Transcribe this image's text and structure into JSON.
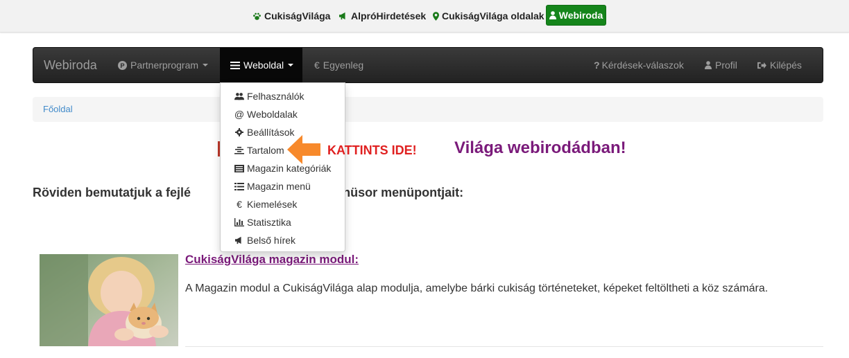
{
  "topbar": {
    "links": [
      {
        "label": "CukiságVilága",
        "icon": "paw-icon"
      },
      {
        "label": "AlpróHirdetések",
        "icon": "bullhorn-icon"
      },
      {
        "label": "CukiságVilága oldalak",
        "icon": "map-marker-icon"
      }
    ],
    "webiroda_button": "Webiroda",
    "accent": "#15851b"
  },
  "navbar": {
    "brand": "Webiroda",
    "items_left": [
      {
        "label": "Partnerprogram",
        "icon": "p-circle-icon",
        "dropdown": true
      },
      {
        "label": "Weboldal",
        "icon": "list-icon",
        "dropdown": true,
        "active": true
      },
      {
        "label": "Egyenleg",
        "icon": "euro-icon"
      }
    ],
    "items_right": [
      {
        "label": "Kérdések-válaszok",
        "icon": "question-icon"
      },
      {
        "label": "Profil",
        "icon": "user-icon"
      },
      {
        "label": "Kilépés",
        "icon": "logout-icon"
      }
    ]
  },
  "dropdown": {
    "items": [
      {
        "label": "Felhasználók",
        "icon": "users-icon"
      },
      {
        "label": "Weboldalak",
        "icon": "at-icon"
      },
      {
        "label": "Beállítások",
        "icon": "gear-icon"
      },
      {
        "label": "Tartalom",
        "icon": "align-center-icon"
      },
      {
        "label": "Magazin kategóriák",
        "icon": "list-alt-icon"
      },
      {
        "label": "Magazin menü",
        "icon": "list-icon"
      },
      {
        "label": "Kiemelések",
        "icon": "euro-icon"
      },
      {
        "label": "Statisztika",
        "icon": "bar-chart-icon"
      },
      {
        "label": "Belső hírek",
        "icon": "bullhorn-icon"
      }
    ]
  },
  "breadcrumb": {
    "home": "Főoldal"
  },
  "welcome_heading": "Világa webirodádban!",
  "annotation": {
    "text": "KATTINTS IDE!"
  },
  "intro": {
    "left": "Röviden bemutatjuk a fejlé",
    "right": "gfelső menüsor menüpontjait:"
  },
  "article": {
    "title": "CukiságVilága magazin modul:",
    "body": "A Magazin modul a CukiságVilága alap modulja, amelybe bárki cukiság történeteket, képeket feltöltheti a köz számára."
  }
}
